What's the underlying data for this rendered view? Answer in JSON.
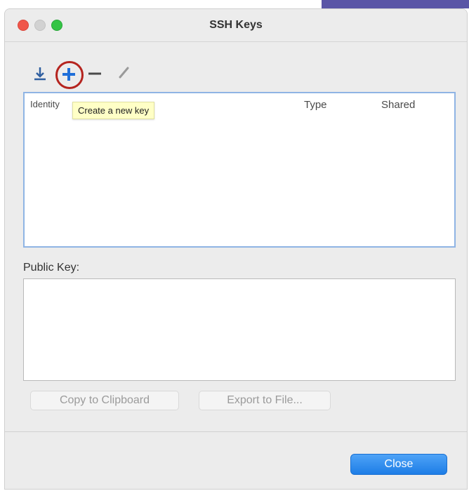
{
  "window": {
    "title": "SSH Keys"
  },
  "toolbar": {
    "import_icon": "import-icon",
    "add_icon": "plus-icon",
    "remove_icon": "minus-icon",
    "edit_icon": "pencil-icon",
    "add_tooltip": "Create a new key"
  },
  "table": {
    "columns": [
      "Identity",
      "Type",
      "Shared"
    ],
    "rows": []
  },
  "public_key": {
    "label": "Public Key:",
    "value": ""
  },
  "actions": {
    "copy_label": "Copy to Clipboard",
    "export_label": "Export to File...",
    "close_label": "Close"
  },
  "colors": {
    "accent": "#1d7de6",
    "highlight_ring": "#b5241f",
    "tooltip_bg": "#ffffc6"
  }
}
